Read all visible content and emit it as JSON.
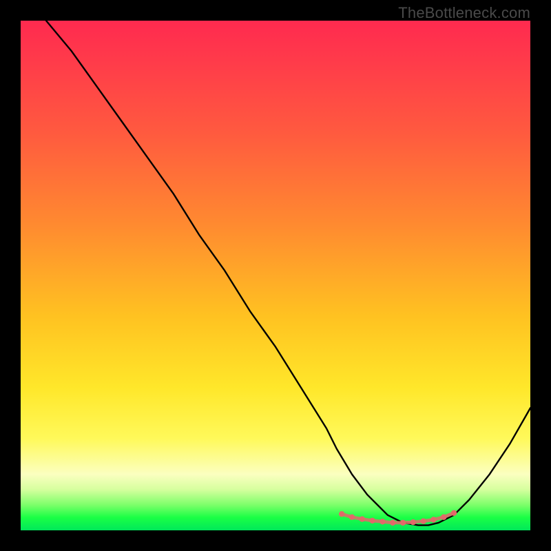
{
  "watermark": "TheBottleneck.com",
  "chart_data": {
    "type": "line",
    "title": "",
    "xlabel": "",
    "ylabel": "",
    "xlim": [
      0,
      100
    ],
    "ylim": [
      0,
      100
    ],
    "series": [
      {
        "name": "bottleneck-curve",
        "x": [
          5,
          10,
          15,
          20,
          25,
          30,
          35,
          40,
          45,
          50,
          55,
          60,
          62,
          65,
          68,
          70,
          72,
          75,
          78,
          80,
          82,
          85,
          88,
          92,
          96,
          100
        ],
        "y": [
          100,
          94,
          87,
          80,
          73,
          66,
          58,
          51,
          43,
          36,
          28,
          20,
          16,
          11,
          7,
          5,
          3,
          1.5,
          1,
          1,
          1.5,
          3,
          6,
          11,
          17,
          24
        ]
      }
    ],
    "highlight_points": {
      "name": "optimal-range-dots",
      "color": "#e06a6a",
      "x": [
        63,
        65,
        67,
        69,
        71,
        73,
        75,
        77,
        79,
        81,
        83,
        85
      ],
      "y": [
        3.2,
        2.6,
        2.2,
        1.9,
        1.7,
        1.5,
        1.5,
        1.6,
        1.8,
        2.1,
        2.6,
        3.4
      ]
    },
    "gradient_stops": [
      {
        "pos": 0.0,
        "color": "#ff2a4f"
      },
      {
        "pos": 0.4,
        "color": "#ff8a30"
      },
      {
        "pos": 0.72,
        "color": "#ffe72a"
      },
      {
        "pos": 0.92,
        "color": "#d6ff9e"
      },
      {
        "pos": 1.0,
        "color": "#00e85a"
      }
    ]
  }
}
